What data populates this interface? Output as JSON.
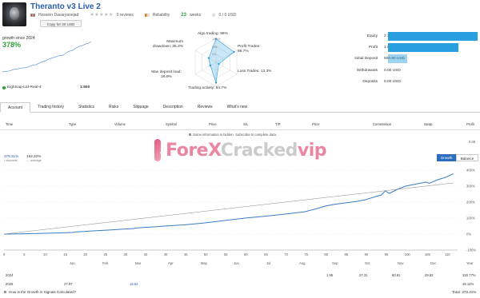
{
  "header": {
    "title": "Theranto v3 Live 2",
    "author": "Hossein Davaryanejad",
    "reviews": "0 reviews",
    "reliability": "Reliability",
    "weeks_num": "23",
    "weeks_label": "weeks",
    "subscribers": "0 / 0 USD",
    "copy_button": "Copy for 30 USD"
  },
  "growth": {
    "label": "growth since 2024",
    "value": "378%",
    "account": "Eightcap-Ltd-Real-4",
    "leverage": "1:500"
  },
  "radar": {
    "algo": "Algo trading: 98%",
    "profit_trades": "Profit Trades: 86.7%",
    "loss_trades": "Loss Trades: 13.3%",
    "trading_activity": "Trading activity: 84.7%",
    "max_deposit_load": "Max deposit load: 26.9%",
    "max_drawdown": "Maximum drawdown: 35.3%",
    "ring_100": "100+%",
    "ring_50": "50%",
    "ring_0": "0%"
  },
  "metrics": [
    {
      "label": "Equity",
      "value": "2 395.85 USD",
      "fraction": 1.0
    },
    {
      "label": "Profit",
      "value": "1 894.95 USD",
      "fraction": 0.79
    },
    {
      "label": "Initial Deposit",
      "value": "500.90 USD",
      "fraction": 0.21
    },
    {
      "label": "Withdrawals",
      "value": "0.00 USD",
      "fraction": 0
    },
    {
      "label": "Deposits",
      "value": "0.00 USD",
      "fraction": 0
    }
  ],
  "tabs": [
    "Account",
    "Trading history",
    "Statistics",
    "Risks",
    "Slippage",
    "Description",
    "Reviews",
    "What's new"
  ],
  "table_headers": [
    "Time",
    "Type",
    "Volume",
    "Symbol",
    "Price",
    "S/L",
    "T/P",
    "Price",
    "Commission",
    "Swap",
    "Profit"
  ],
  "notice": "Some information is hidden. Subscribe to complete data.",
  "zero_value": "0.00",
  "watermark": {
    "part1": "ForeX",
    "part2": "Cracked",
    "part3": "vip"
  },
  "growth_legend": {
    "v1": "378.31%",
    "v1_sub": "deposits",
    "v2": "162.22%",
    "v2_sub": "average"
  },
  "buttons": {
    "growth": "Growth",
    "balance": "Balance"
  },
  "chart_data": {
    "type": "line",
    "y_tick_labels": [
      "400%",
      "300%",
      "200%",
      "100%",
      "0%",
      "-100%"
    ],
    "x_tick_labels": [
      "0",
      "5",
      "10",
      "15",
      "20",
      "25",
      "30",
      "35",
      "40",
      "45",
      "50",
      "55",
      "60",
      "65",
      "70",
      "75",
      "80",
      "85",
      "90",
      "95",
      "100",
      "105",
      "110"
    ],
    "month_labels": [
      "Jan",
      "Feb",
      "Mar",
      "Apr",
      "May",
      "Jun",
      "Jul",
      "Aug",
      "Sep",
      "Oct",
      "Nov",
      "Dec",
      "Year"
    ],
    "ylim": [
      -100,
      400
    ],
    "xlim": [
      0,
      113
    ],
    "series": [
      {
        "x": [
          0,
          5,
          10,
          15,
          17,
          18,
          20,
          22,
          25,
          28,
          30,
          32,
          33,
          35,
          38,
          40,
          45,
          50,
          55,
          60,
          65,
          70,
          75,
          78,
          80,
          82,
          85,
          88,
          90,
          92,
          94,
          95,
          96,
          98,
          100,
          101,
          102,
          104,
          105,
          106,
          108,
          110,
          112
        ],
        "values": [
          0,
          2,
          5,
          8,
          10,
          14,
          16,
          20,
          24,
          28,
          32,
          34,
          38,
          42,
          46,
          50,
          58,
          70,
          85,
          100,
          112,
          125,
          140,
          160,
          175,
          185,
          195,
          205,
          215,
          230,
          245,
          270,
          255,
          280,
          300,
          305,
          310,
          320,
          325,
          318,
          340,
          355,
          378
        ]
      },
      {
        "x": [
          0,
          112
        ],
        "values": [
          0,
          320
        ]
      }
    ]
  },
  "year_rows": [
    {
      "year": "2024",
      "cells": [
        "",
        "",
        "",
        "",
        "",
        "",
        "",
        "",
        "1.95",
        "27.31",
        "90.81",
        "29.52"
      ],
      "total": "320.77%"
    },
    {
      "year": "2025",
      "cells": [
        "27.97",
        "",
        "16.62",
        "",
        "",
        "",
        "",
        "",
        "",
        "",
        "",
        ""
      ],
      "total": "49.12%"
    }
  ],
  "footer": {
    "question": "How is the Growth in Signals Calculated?",
    "total": "Total: 378.31%"
  }
}
